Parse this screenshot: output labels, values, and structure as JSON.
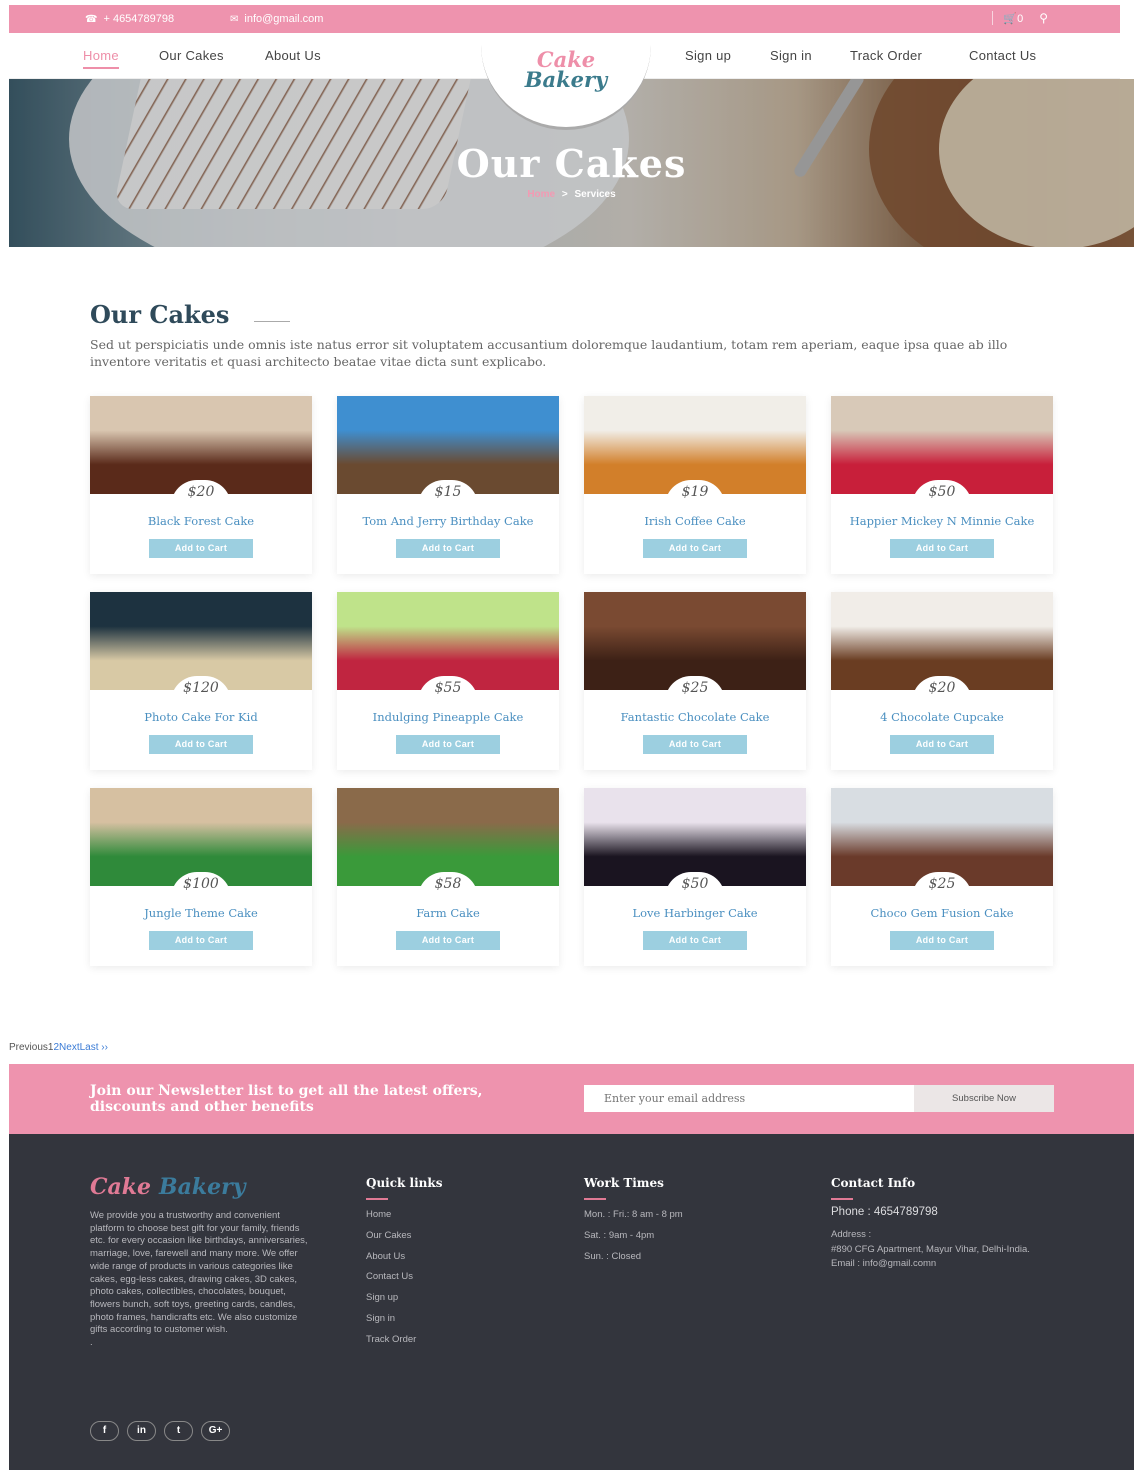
{
  "topbar": {
    "phone": "+ 4654789798",
    "email": "info@gmail.com",
    "cart": "0"
  },
  "nav": {
    "left": [
      "Home",
      "Our Cakes",
      "About Us"
    ],
    "right": [
      "Sign up",
      "Sign in",
      "Track Order",
      "Contact Us"
    ],
    "logo_line1": "Cake",
    "logo_line2": "Bakery"
  },
  "hero": {
    "title": "Our Cakes",
    "crumb_home": "Home",
    "crumb_sep": ">",
    "crumb_current": "Services"
  },
  "section": {
    "title": "Our Cakes",
    "description": "Sed ut perspiciatis unde omnis iste natus error sit voluptatem accusantium doloremque laudantium, totam rem aperiam, eaque ipsa quae ab illo inventore veritatis et quasi architecto beatae vitae dicta sunt explicabo."
  },
  "add_to_cart_label": "Add to Cart",
  "products": [
    {
      "name": "Black Forest Cake",
      "price": "$20",
      "colors": [
        "#d9c6b0",
        "#5a2a1a"
      ]
    },
    {
      "name": "Tom And Jerry Birthday Cake",
      "price": "$15",
      "colors": [
        "#3f8fd0",
        "#6a4a30"
      ]
    },
    {
      "name": "Irish Coffee Cake",
      "price": "$19",
      "colors": [
        "#f1eee8",
        "#d27f2a"
      ]
    },
    {
      "name": "Happier Mickey N Minnie Cake",
      "price": "$50",
      "colors": [
        "#d8c9b8",
        "#c81f3a"
      ]
    },
    {
      "name": "Photo Cake For Kid",
      "price": "$120",
      "colors": [
        "#1d3240",
        "#d8c9a5"
      ]
    },
    {
      "name": "Indulging Pineapple Cake",
      "price": "$55",
      "colors": [
        "#bfe38a",
        "#c02540"
      ]
    },
    {
      "name": "Fantastic Chocolate Cake",
      "price": "$25",
      "colors": [
        "#7a4a32",
        "#3d2116"
      ]
    },
    {
      "name": "4 Chocolate Cupcake",
      "price": "$20",
      "colors": [
        "#f1ede8",
        "#6a3d22"
      ]
    },
    {
      "name": "Jungle Theme Cake",
      "price": "$100",
      "colors": [
        "#d6c0a1",
        "#2f8a3a"
      ]
    },
    {
      "name": "Farm Cake",
      "price": "$58",
      "colors": [
        "#8a6a4a",
        "#3a9a3a"
      ]
    },
    {
      "name": "Love Harbinger Cake",
      "price": "$50",
      "colors": [
        "#e9e2ec",
        "#1a1420"
      ]
    },
    {
      "name": "Choco Gem Fusion Cake",
      "price": "$25",
      "colors": [
        "#d8dde2",
        "#6a3a2a"
      ]
    }
  ],
  "pager": {
    "previous": "Previous",
    "page1": "1",
    "page2": "2",
    "next": "Next",
    "last": "Last ››"
  },
  "newsletter": {
    "text": "Join our Newsletter list to get all the latest offers, discounts and other benefits",
    "placeholder": "Enter your email address",
    "button": "Subscribe Now"
  },
  "footer": {
    "logo_a": "Cake",
    "logo_b": "Bakery",
    "about": "We provide you a trustworthy and convenient platform to choose best gift for your family, friends etc. for every occasion like birthdays, anniversaries, marriage, love, farewell and many more. We offer wide range of products in various categories like cakes, egg-less cakes, drawing cakes, 3D cakes, photo cakes, collectibles, chocolates, bouquet, flowers bunch, soft toys, greeting cards, candles, photo frames, handicrafts etc. We also customize gifts according to customer wish.",
    "about_extra": ".",
    "quick_title": "Quick links",
    "quick_links": [
      "Home",
      "Our Cakes",
      "About Us",
      "Contact Us",
      "Sign up",
      "Sign in",
      "Track Order"
    ],
    "work_title": "Work Times",
    "work_times": [
      "Mon. : Fri.: 8 am - 8 pm",
      "Sat. : 9am - 4pm",
      "Sun. : Closed"
    ],
    "contact_title": "Contact Info",
    "phone": "Phone : 4654789798",
    "address_label": "Address :",
    "address": "#890 CFG Apartment, Mayur Vihar, Delhi-India.",
    "email": "Email : info@gmail.comn",
    "socials": [
      "f",
      "in",
      "t",
      "G+"
    ]
  },
  "colors": {
    "brand_pink": "#ee93ae",
    "link_blue": "#4a8fc0",
    "button_blue": "#9ccfe0",
    "footer_bg": "#33353d"
  }
}
